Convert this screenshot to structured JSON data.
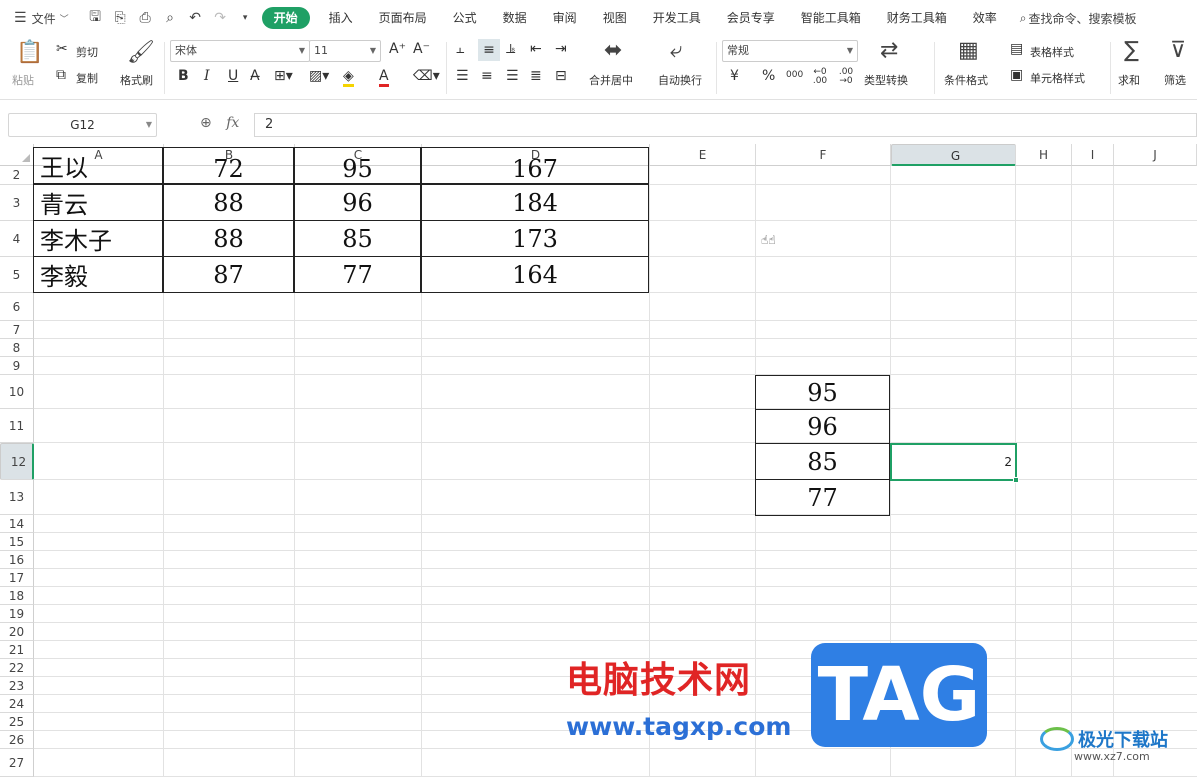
{
  "topbar": {
    "file_menu": "文件",
    "tabs": [
      "开始",
      "插入",
      "页面布局",
      "公式",
      "数据",
      "审阅",
      "视图",
      "开发工具",
      "会员专享",
      "智能工具箱",
      "财务工具箱",
      "效率"
    ],
    "search": "查找命令、搜索模板"
  },
  "ribbon": {
    "paste": "粘贴",
    "cut": "剪切",
    "copy": "复制",
    "format_painter": "格式刷",
    "font_name": "宋体",
    "font_size": "11",
    "merge_center": "合并居中",
    "wrap": "自动换行",
    "number_format": "常规",
    "type_convert": "类型转换",
    "cond_format": "条件格式",
    "table_style": "表格样式",
    "cell_style": "单元格样式",
    "sum": "求和",
    "filter": "筛选",
    "bold": "B",
    "italic": "I",
    "underline": "U",
    "currency": "¥",
    "percent": "%",
    "thousands": "000",
    "dec_inc": "←0 .00",
    "dec_dec": ".00 →0"
  },
  "formula_bar": {
    "cell_ref": "G12",
    "fx": "fx",
    "value": "2"
  },
  "columns": [
    "A",
    "B",
    "C",
    "D",
    "E",
    "F",
    "G",
    "H",
    "I",
    "J"
  ],
  "rows": [
    "2",
    "3",
    "4",
    "5",
    "6",
    "7",
    "8",
    "9",
    "10",
    "11",
    "12",
    "13",
    "14",
    "15",
    "16",
    "17",
    "18",
    "19",
    "20",
    "21",
    "22",
    "23",
    "24",
    "25",
    "26",
    "27"
  ],
  "table": [
    {
      "name": "王以",
      "b": "72",
      "c": "95",
      "d": "167"
    },
    {
      "name": "青云",
      "b": "88",
      "c": "96",
      "d": "184"
    },
    {
      "name": "李木子",
      "b": "88",
      "c": "85",
      "d": "173"
    },
    {
      "name": "李毅",
      "b": "87",
      "c": "77",
      "d": "164"
    }
  ],
  "fcol": [
    "95",
    "96",
    "85",
    "77"
  ],
  "g12_value": "2",
  "watermark": {
    "cn": "电脑技术网",
    "url": "www.tagxp.com",
    "tag": "TAG",
    "site_name": "极光下载站",
    "site_url": "www.xz7.com"
  },
  "colors": {
    "accent": "#1fa065",
    "grid": "#e2e2e2",
    "border": "#222222"
  }
}
